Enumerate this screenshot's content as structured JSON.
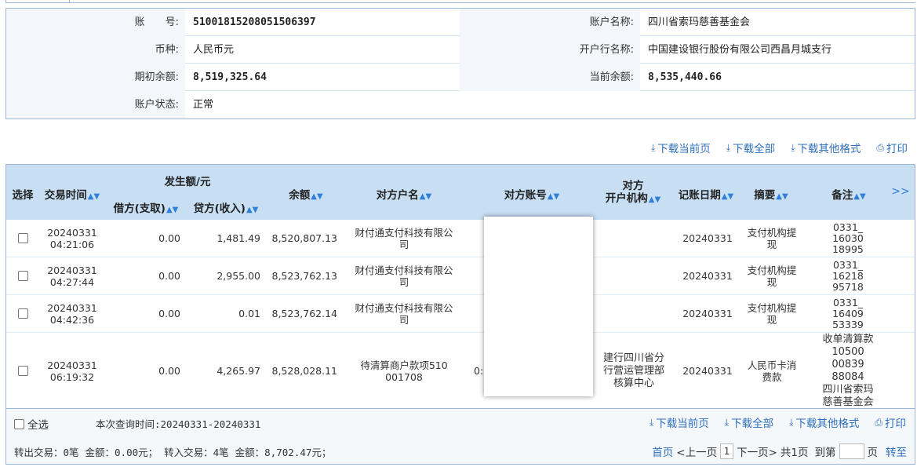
{
  "account": {
    "rows": [
      {
        "l1": "账　　号:",
        "v1": "51001815208051506397",
        "l2": "账户名称:",
        "v2": "四川省索玛慈善基金会"
      },
      {
        "l1": "币种:",
        "v1": "人民币元",
        "l2": "开户行名称:",
        "v2": "中国建设银行股份有限公司西昌月城支行"
      },
      {
        "l1": "期初余额:",
        "v1": "8,519,325.64",
        "l2": "当前余额:",
        "v2": "8,535,440.66"
      },
      {
        "l1": "账户状态:",
        "v1": "正常",
        "l2": "",
        "v2": ""
      }
    ]
  },
  "actions": {
    "download_current": "下载当前页",
    "download_all": "下载全部",
    "download_other": "下载其他格式",
    "print": "打印"
  },
  "table": {
    "headers": {
      "select": "选择",
      "time": "交易时间",
      "amount_group": "发生额/元",
      "debit": "借方(支取)",
      "credit": "贷方(收入)",
      "balance": "余额",
      "party_name": "对方户名",
      "party_account": "对方账号",
      "party_bank_1": "对方",
      "party_bank_2": "开户机构",
      "post_date": "记账日期",
      "summary": "摘要",
      "remark": "备注",
      "more": ">>"
    },
    "rows": [
      {
        "date": "20240331",
        "time": "04:21:06",
        "debit": "0.00",
        "credit": "1,481.49",
        "balance": "8,520,807.13",
        "party1": "财付通支付科技有限公",
        "party2": "司",
        "acct": "",
        "bank1": "",
        "bank2": "",
        "bank3": "",
        "post": "20240331",
        "sum1": "支付机构提",
        "sum2": "现",
        "rem1": "0331_",
        "rem2": "16030",
        "rem3": "18995",
        "rem4": "",
        "rem5": "",
        "rem6": "",
        "rem7": ""
      },
      {
        "date": "20240331",
        "time": "04:27:44",
        "debit": "0.00",
        "credit": "2,955.00",
        "balance": "8,523,762.13",
        "party1": "财付通支付科技有限公",
        "party2": "司",
        "acct": "",
        "bank1": "",
        "bank2": "",
        "bank3": "",
        "post": "20240331",
        "sum1": "支付机构提",
        "sum2": "现",
        "rem1": "0331_",
        "rem2": "16218",
        "rem3": "95718",
        "rem4": "",
        "rem5": "",
        "rem6": "",
        "rem7": ""
      },
      {
        "date": "20240331",
        "time": "04:42:36",
        "debit": "0.00",
        "credit": "0.01",
        "balance": "8,523,762.14",
        "party1": "财付通支付科技有限公",
        "party2": "司",
        "acct": "",
        "bank1": "",
        "bank2": "",
        "bank3": "",
        "post": "20240331",
        "sum1": "支付机构提",
        "sum2": "现",
        "rem1": "0331_",
        "rem2": "16409",
        "rem3": "53339",
        "rem4": "",
        "rem5": "",
        "rem6": "",
        "rem7": ""
      },
      {
        "date": "20240331",
        "time": "06:19:32",
        "debit": "0.00",
        "credit": "4,265.97",
        "balance": "8,528,028.11",
        "party1": "待清算商户款项510",
        "party2": "001708",
        "acct": "0:",
        "bank1": "建行四川省分",
        "bank2": "行营运管理部",
        "bank3": "核算中心",
        "post": "20240331",
        "sum1": "人民币卡消",
        "sum2": "费款",
        "rem1": "收单清算款",
        "rem2": "10500",
        "rem3": "00839",
        "rem4": "88084",
        "rem5": "四川省索玛",
        "rem6": "慈善基金会",
        "rem7": ""
      }
    ]
  },
  "footer": {
    "select_all": "全选",
    "query_time": "本次查询时间:20240331-20240331",
    "out_count": "转出交易：0笔",
    "out_amount": "金额：0.00元；",
    "in_count": "转入交易：4笔",
    "in_amount": "金额：8,702.47元；",
    "first": "首页",
    "prev": "<上一页",
    "page": "1",
    "next": "下一页>",
    "total": "共1页",
    "goto": "到第",
    "page_unit": "页",
    "go": "转至"
  }
}
